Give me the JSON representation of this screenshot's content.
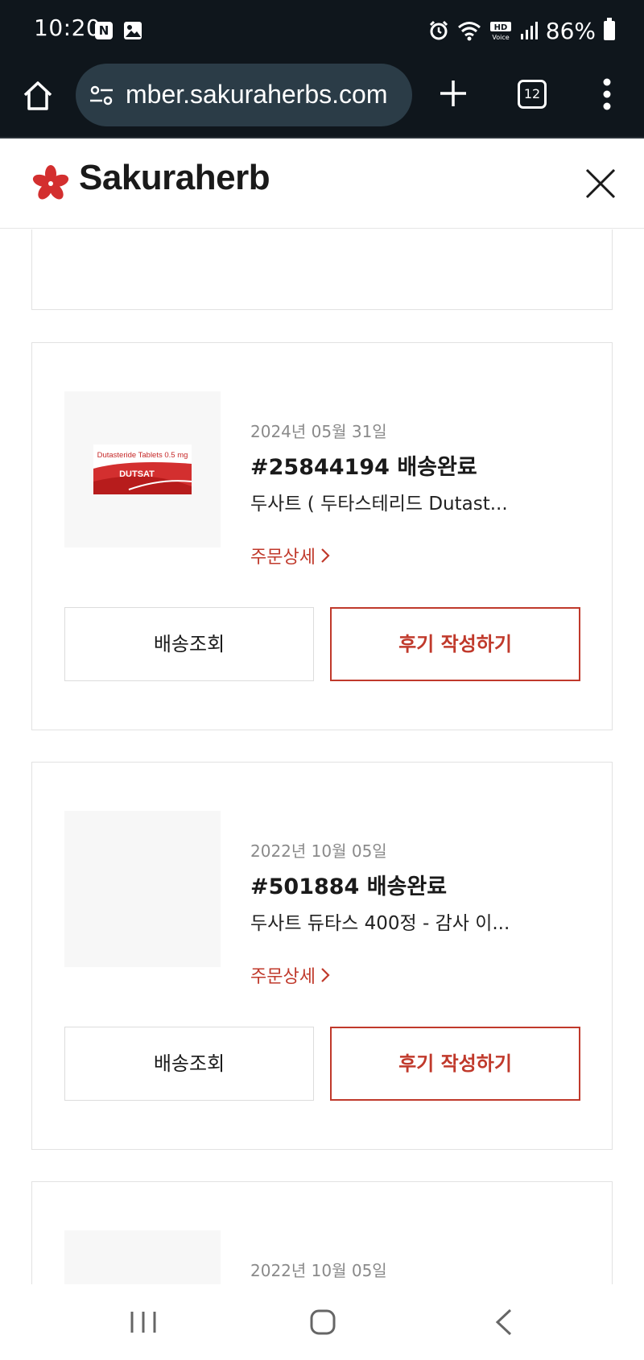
{
  "status_bar": {
    "time": "10:20",
    "notification_icons": [
      "naver-icon",
      "image-icon"
    ],
    "battery_text": "86%",
    "status_icons": [
      "alarm-icon",
      "wifi-icon",
      "hd-voice-icon",
      "signal-icon",
      "battery-icon"
    ]
  },
  "browser": {
    "url": "mber.sakuraherbs.com",
    "tab_count": "12"
  },
  "site": {
    "logo_text": "Sakuraherb",
    "brand_color": "#d32f2f",
    "accent_color": "#c0392b"
  },
  "orders": [
    {
      "date": "2024년 05월 31일",
      "title": "#25844194 배송완료",
      "product": "두사트 ( 두타스테리드 Dutast...",
      "detail_label": "주문상세",
      "track_label": "배송조회",
      "review_label": "후기 작성하기",
      "thumb_label": "Dutasteride Tablets 0.5 mg",
      "thumb_brand": "DUTSAT"
    },
    {
      "date": "2022년 10월 05일",
      "title": "#501884 배송완료",
      "product": "두사트 듀타스 400정 - 감사 이...",
      "detail_label": "주문상세",
      "track_label": "배송조회",
      "review_label": "후기 작성하기"
    },
    {
      "date": "2022년 10월 05일"
    }
  ]
}
